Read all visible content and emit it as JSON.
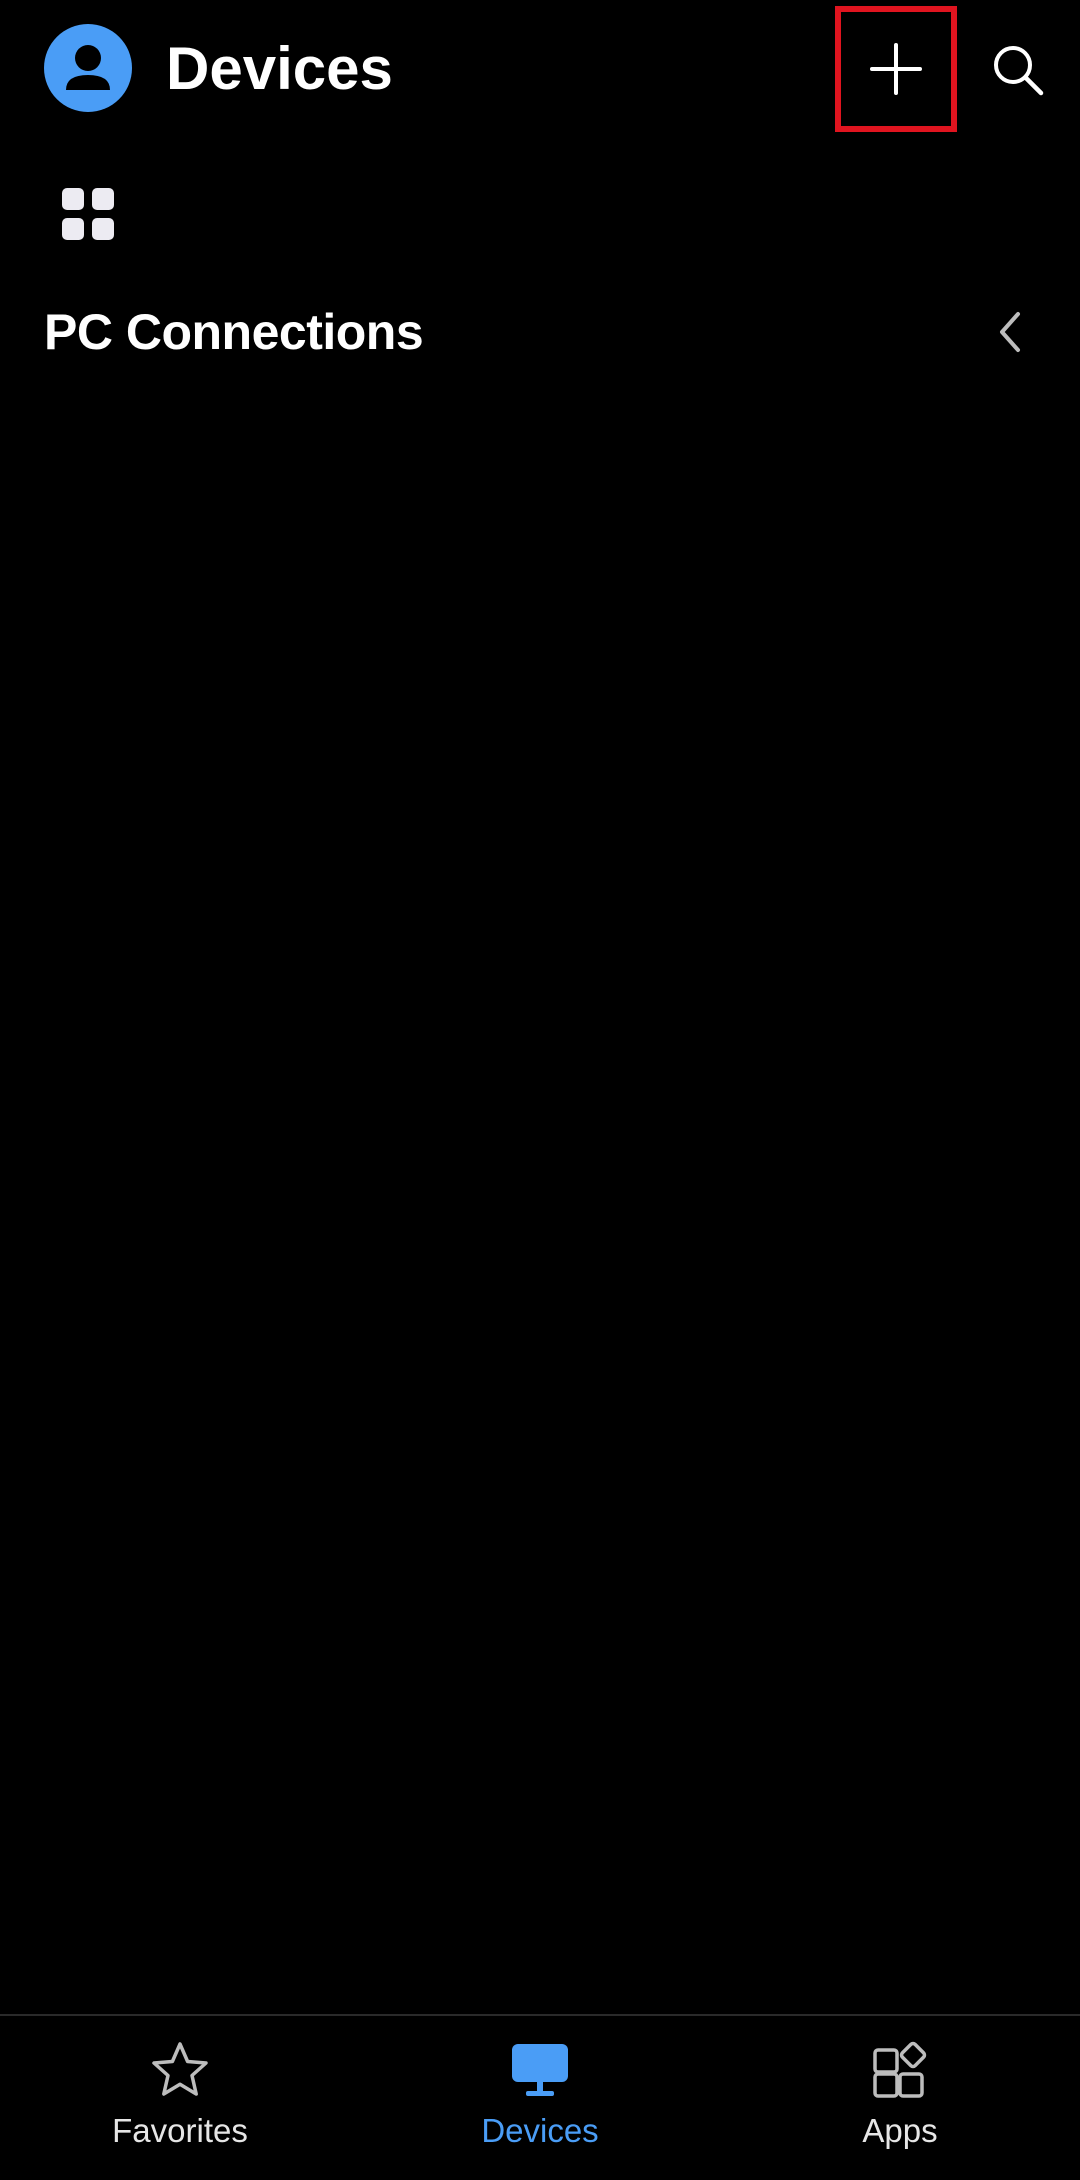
{
  "header": {
    "title": "Devices",
    "avatar_icon": "person-avatar-icon",
    "add_icon": "plus-icon",
    "search_icon": "search-icon"
  },
  "view_toggle": {
    "icon": "grid-view-icon"
  },
  "section": {
    "title": "PC Connections",
    "toggle_icon": "chevron-left-icon"
  },
  "bottom_nav": {
    "items": [
      {
        "label": "Favorites",
        "icon": "star-icon",
        "active": false
      },
      {
        "label": "Devices",
        "icon": "monitor-icon",
        "active": true
      },
      {
        "label": "Apps",
        "icon": "apps-icon",
        "active": false
      }
    ]
  },
  "colors": {
    "accent": "#4a9df6",
    "background": "#000000",
    "highlight_box": "#e0141f",
    "text": "#ffffff"
  }
}
